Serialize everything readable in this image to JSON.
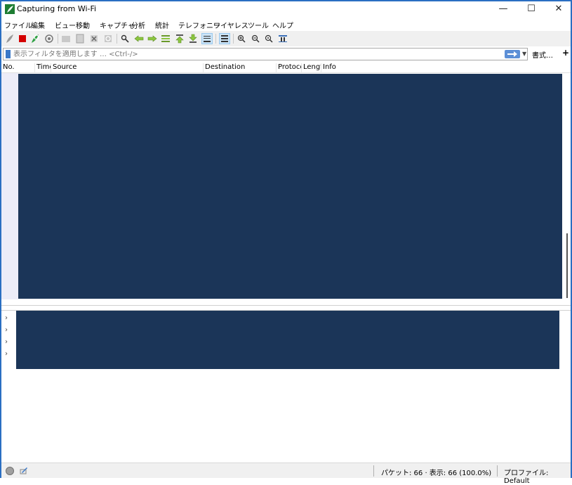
{
  "window": {
    "title": "Capturing from Wi-Fi",
    "controls": {
      "minimize": "—",
      "maximize": "☐",
      "close": "✕"
    }
  },
  "menu": {
    "items": [
      "ファイル",
      "編集",
      "ビュー",
      "移動",
      "キャプチャ",
      "分析",
      "統計",
      "テレフォニー",
      "ワイヤレス",
      "ツール",
      "ヘルプ"
    ]
  },
  "toolbar": {
    "icons": [
      "shark-fin-start-icon",
      "stop-icon",
      "restart-icon",
      "capture-options-icon",
      "open-file-icon",
      "save-file-icon",
      "close-file-icon",
      "reload-icon",
      "find-icon",
      "go-back-icon",
      "go-forward-icon",
      "go-to-packet-icon",
      "first-packet-icon",
      "last-packet-icon",
      "autoscroll-icon",
      "colorize-icon",
      "zoom-in-icon",
      "zoom-out-icon",
      "zoom-reset-icon",
      "resize-columns-icon"
    ]
  },
  "filter": {
    "placeholder": "表示フィルタを適用します … <Ctrl-/>",
    "format_label": "書式…",
    "add_label": "+"
  },
  "packet_list": {
    "columns": [
      "No.",
      "Time",
      "Source",
      "Destination",
      "Protocol",
      "Length",
      "Info"
    ]
  },
  "status": {
    "packets": "パケット: 66 · 表示: 66 (100.0%)",
    "profile": "プロファイル: Default"
  },
  "colors": {
    "redaction": "#1b3558",
    "window_border": "#2a6fc2",
    "toolbar_bg": "#f0f0f0"
  }
}
